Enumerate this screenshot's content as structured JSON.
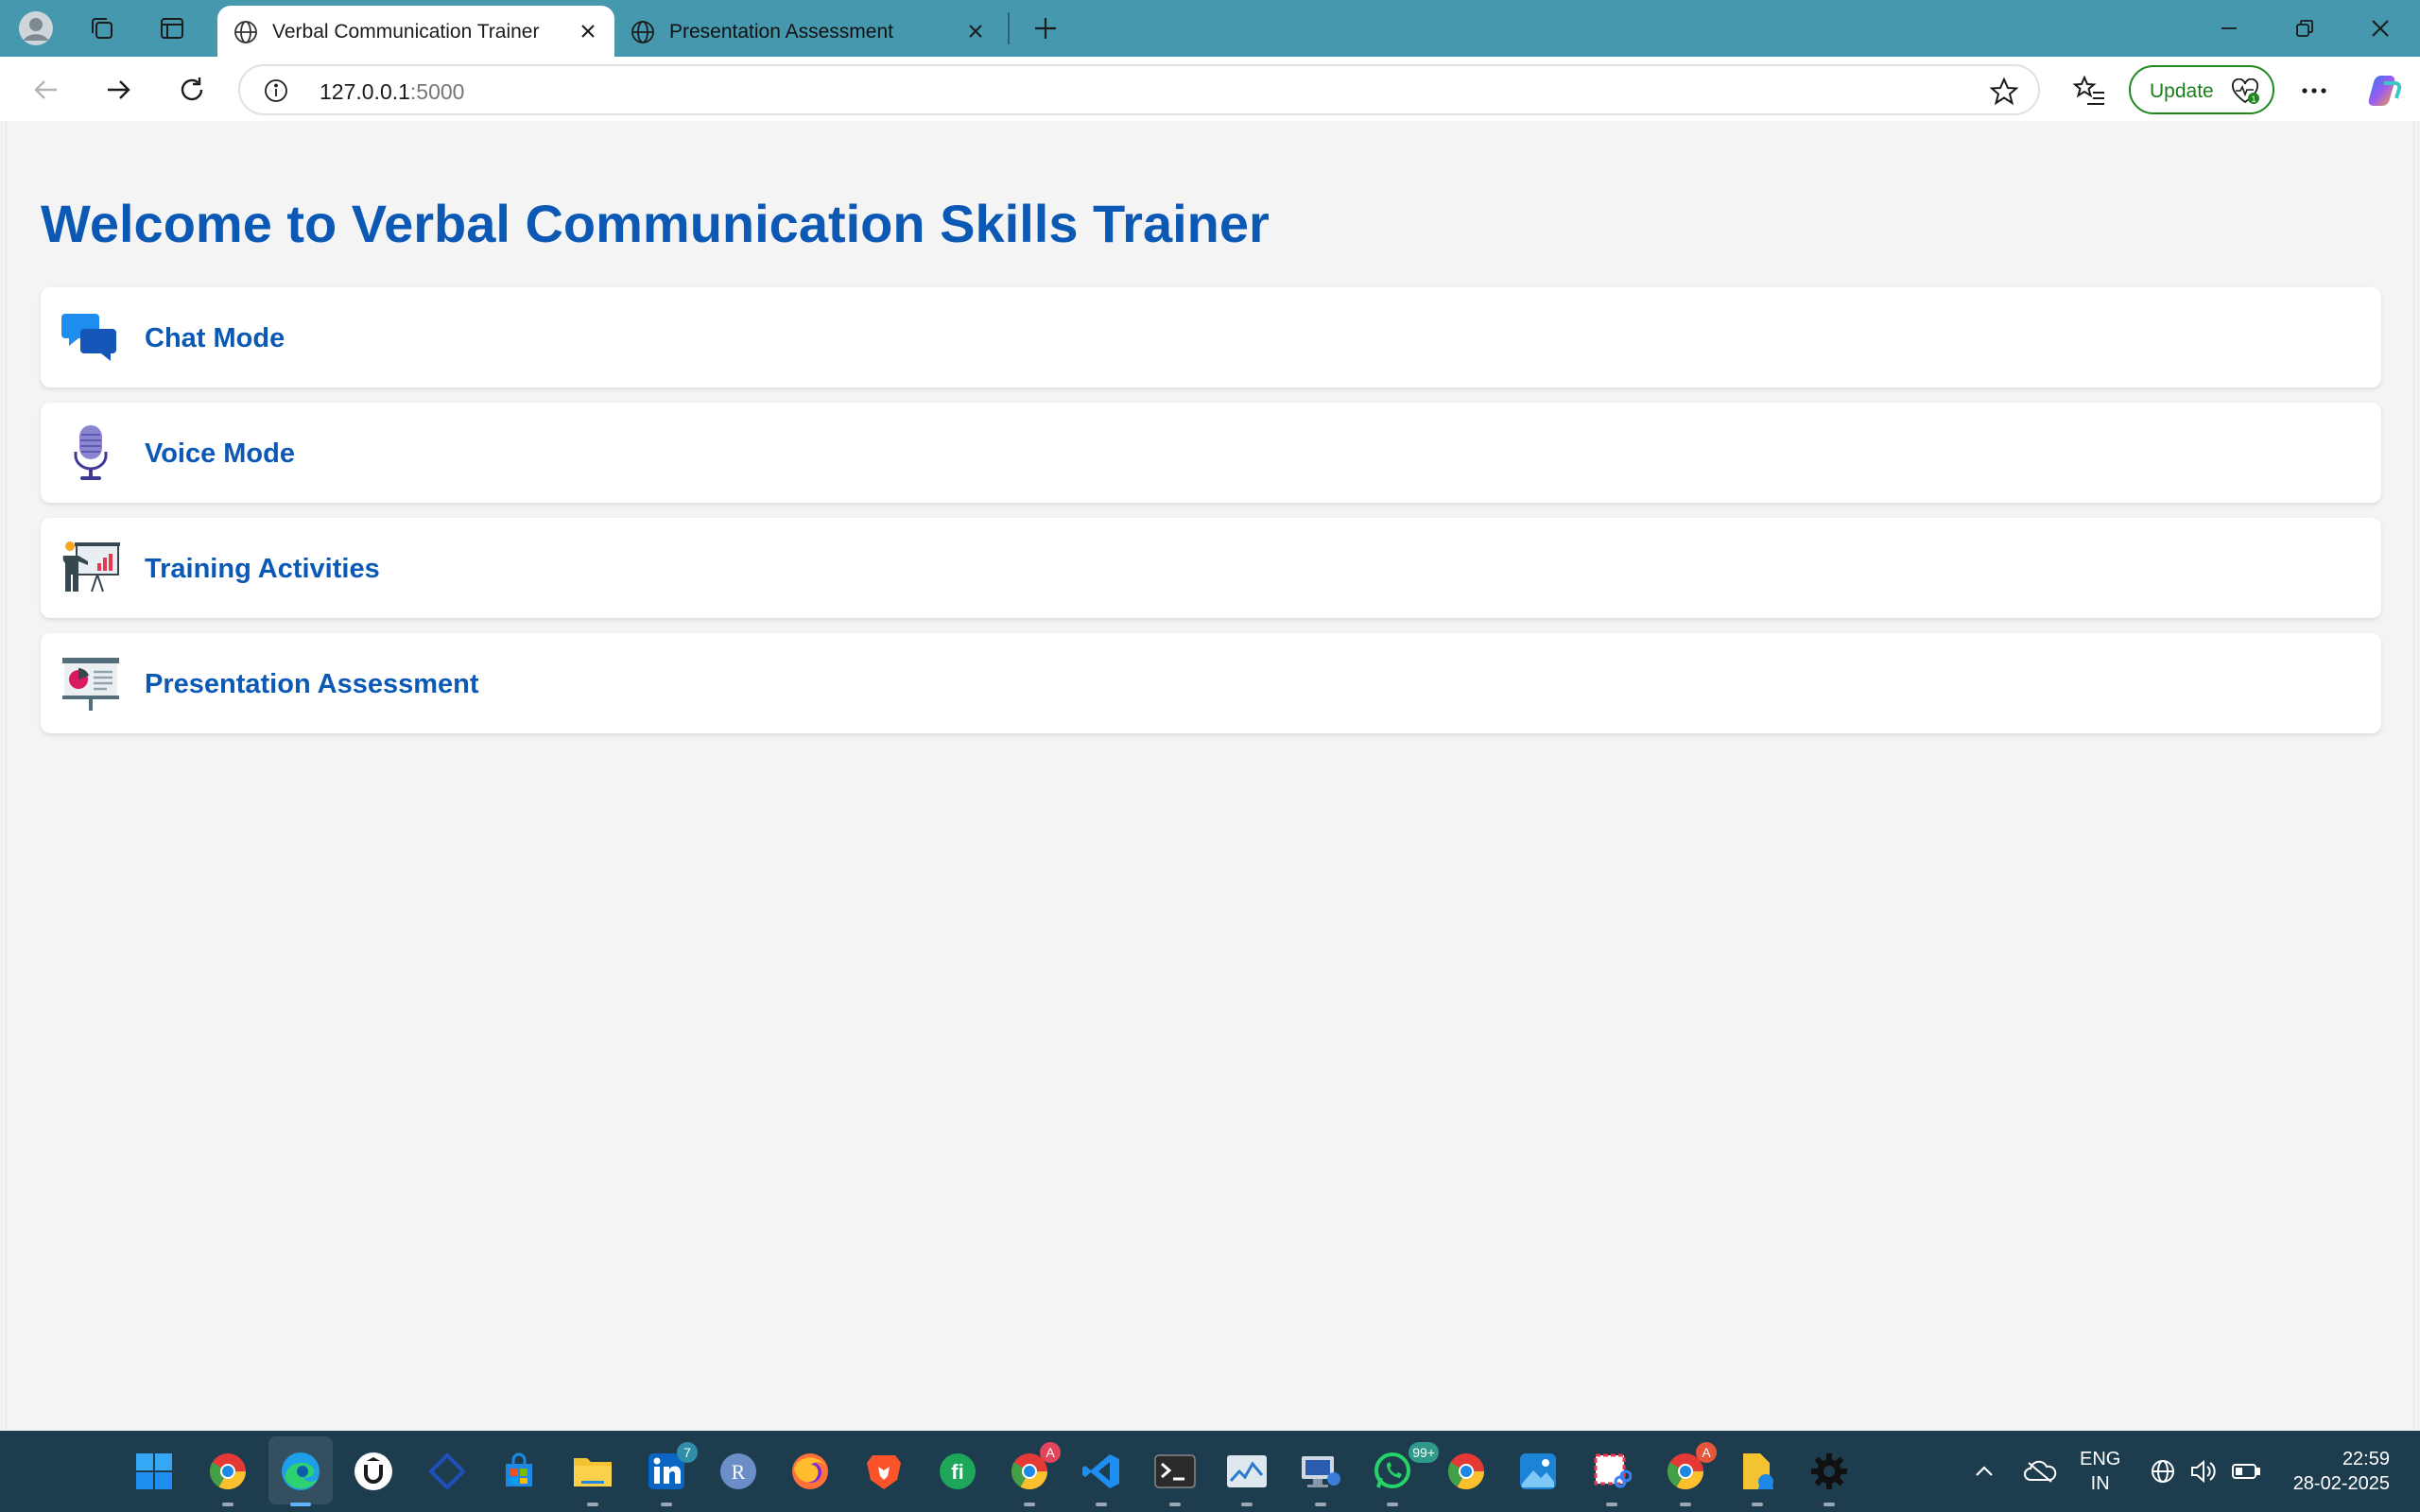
{
  "browser": {
    "tabs": [
      {
        "title": "Verbal Communication Trainer",
        "active": true
      },
      {
        "title": "Presentation Assessment",
        "active": false
      }
    ],
    "url_host": "127.0.0.1",
    "url_port": ":5000",
    "update_label": "Update",
    "update_badge": "1"
  },
  "page": {
    "title": "Welcome to Verbal Communication Skills Trainer",
    "modes": [
      {
        "label": "Chat Mode",
        "icon": "chat-bubbles-icon"
      },
      {
        "label": "Voice Mode",
        "icon": "microphone-icon"
      },
      {
        "label": "Training Activities",
        "icon": "presenter-chart-icon"
      },
      {
        "label": "Presentation Assessment",
        "icon": "presentation-board-icon"
      }
    ]
  },
  "taskbar": {
    "apps": [
      "windows-start",
      "chrome",
      "edge",
      "udemy",
      "vscode-blue",
      "store",
      "file-explorer",
      "linkedin",
      "r-app",
      "firefox",
      "brave",
      "feedly",
      "chrome-profile",
      "vscode",
      "terminal",
      "photos",
      "remote-desktop",
      "whatsapp",
      "chrome-2",
      "photos-2",
      "snipping-tool",
      "chrome-3",
      "file-explorer-2",
      "settings"
    ],
    "badges": {
      "linkedin": "7",
      "whatsapp": "99+",
      "chrome_profile": "A",
      "chrome_3": "A"
    },
    "lang_line1": "ENG",
    "lang_line2": "IN",
    "time": "22:59",
    "date": "28-02-2025"
  },
  "colors": {
    "titlebar": "#4598ad",
    "accent_blue": "#0b59b5",
    "taskbar": "#1d3d4f",
    "update_green": "#1a7f1a"
  }
}
